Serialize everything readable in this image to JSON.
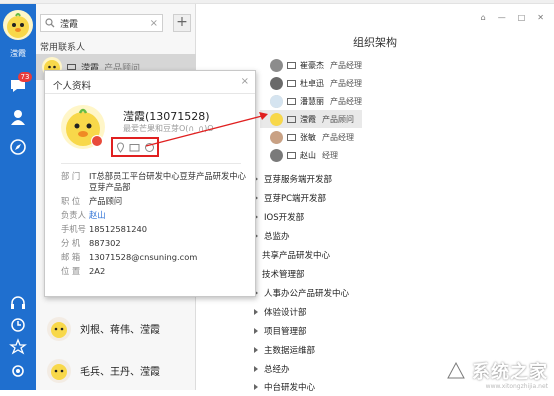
{
  "rail": {
    "username": "滢霞",
    "chat_badge": "73"
  },
  "search": {
    "value": "滢霞",
    "clear": "×"
  },
  "list": {
    "add": "+",
    "section": "常用联系人",
    "selected_name": "滢霞",
    "selected_role": "产品顾问",
    "groups": [
      {
        "label": "刘根、蒋伟、滢霞"
      },
      {
        "label": "毛兵、王丹、滢霞"
      }
    ]
  },
  "org": {
    "title": "组织架构",
    "people": [
      {
        "name": "崔豪杰",
        "role": "产品经理"
      },
      {
        "name": "杜卓迅",
        "role": "产品经理"
      },
      {
        "name": "潘慧丽",
        "role": "产品经理"
      },
      {
        "name": "滢霞",
        "role": "产品顾问"
      },
      {
        "name": "张敏",
        "role": "产品经理"
      },
      {
        "name": "赵山",
        "role": "经理"
      }
    ],
    "depts": [
      {
        "label": "豆芽服务端开发部"
      },
      {
        "label": "豆芽PC端开发部"
      },
      {
        "label": "IOS开发部"
      },
      {
        "label": "总监办"
      },
      {
        "label": "共享产品研发中心"
      },
      {
        "label": "技术管理部"
      },
      {
        "label": "人事办公产品研发中心"
      },
      {
        "label": "体验设计部"
      },
      {
        "label": "项目管理部"
      },
      {
        "label": "主数据运维部"
      },
      {
        "label": "总经办"
      },
      {
        "label": "中台研发中心"
      }
    ]
  },
  "card": {
    "title": "个人资料",
    "close": "×",
    "name": "滢霞(13071528)",
    "signature": "最爱芒果和豆芽O(∩_∩)O",
    "rows": [
      {
        "k": "部  门",
        "v": "IT总部员工平台研发中心豆芽产品研发中心豆芽产品部"
      },
      {
        "k": "职  位",
        "v": "产品顾问"
      },
      {
        "k": "负责人",
        "v": "赵山"
      },
      {
        "k": "手机号",
        "v": "18512581240"
      },
      {
        "k": "分  机",
        "v": "887302"
      },
      {
        "k": "邮  箱",
        "v": "13071528@cnsuning.com"
      },
      {
        "k": "位  置",
        "v": "2A2"
      }
    ]
  },
  "watermark": {
    "brand": "系统之家",
    "sub": "www.xitongzhijia.net"
  },
  "colors": {
    "rail": "#1f6fcf",
    "highlight": "#e02020",
    "link": "#2a6fd6"
  }
}
